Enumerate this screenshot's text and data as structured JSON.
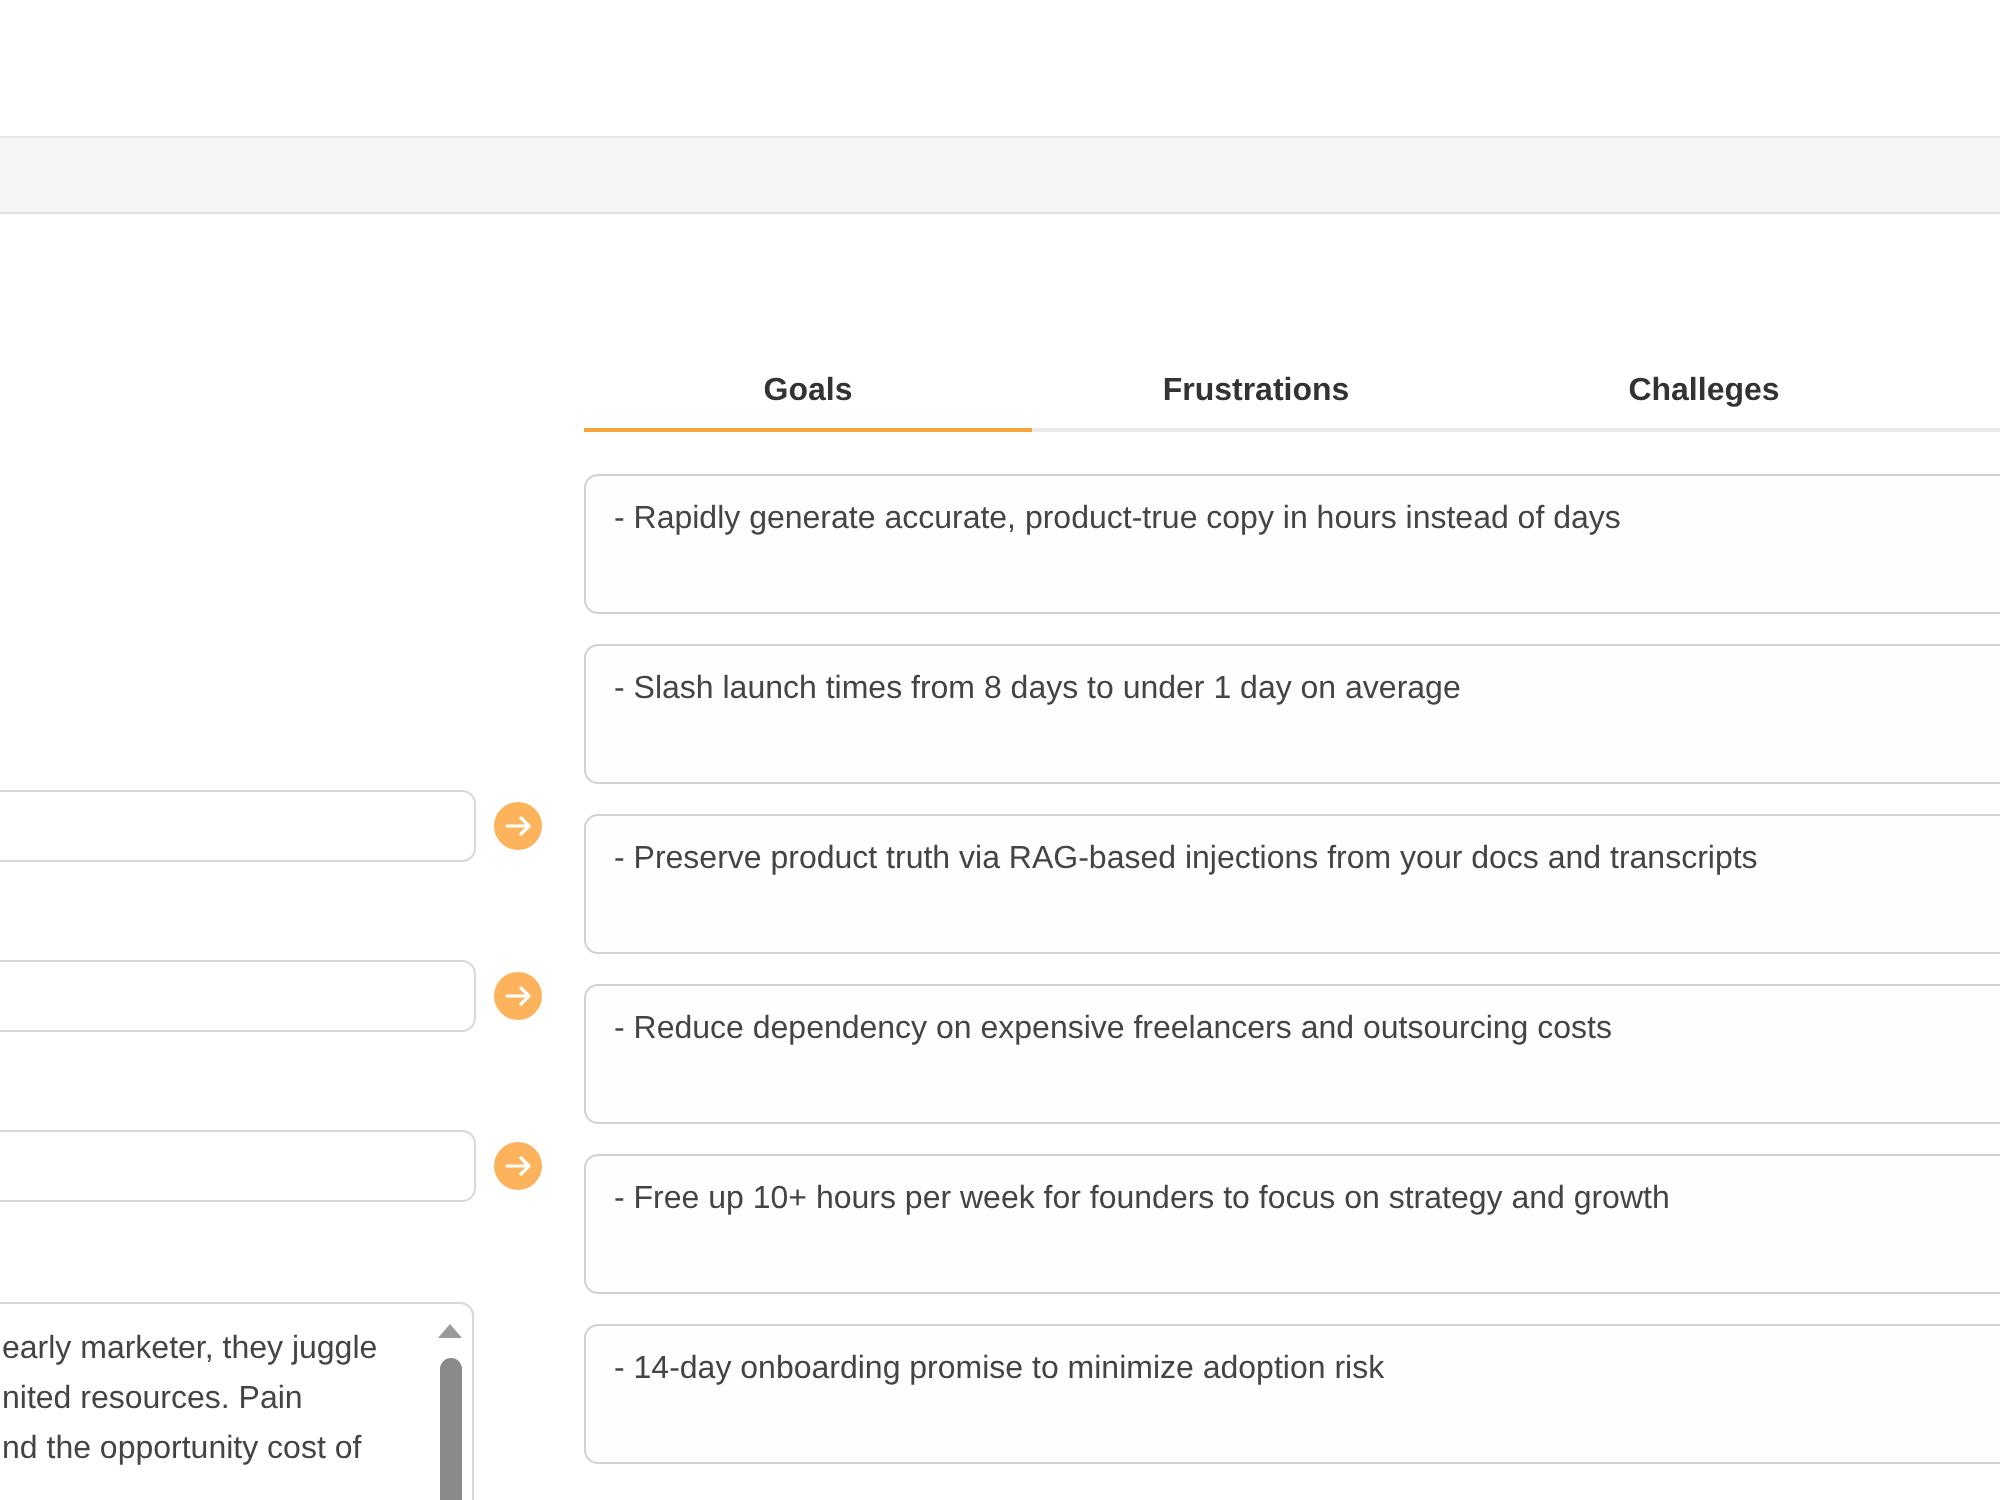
{
  "left_fields": [
    {
      "kind": "input"
    },
    {
      "kind": "input"
    },
    {
      "kind": "input"
    },
    {
      "kind": "textarea",
      "value": "early marketer, they juggle\nnited resources. Pain\nnd the opportunity cost of"
    }
  ],
  "tabs": [
    {
      "label": "Goals",
      "selected": true
    },
    {
      "label": "Frustrations",
      "selected": false
    },
    {
      "label": "Challeges",
      "selected": false
    }
  ],
  "cards": [
    {
      "text": "- Rapidly generate accurate, product-true copy in hours instead of days"
    },
    {
      "text": "- Slash launch times from 8 days to under 1 day on average"
    },
    {
      "text": "- Preserve product truth via RAG-based injections from your docs and transcripts"
    },
    {
      "text": "- Reduce dependency on expensive freelancers and outsourcing costs"
    },
    {
      "text": "- Free up 10+ hours per week for founders to focus on strategy and growth"
    },
    {
      "text": "- 14-day onboarding promise to minimize adoption risk"
    }
  ]
}
